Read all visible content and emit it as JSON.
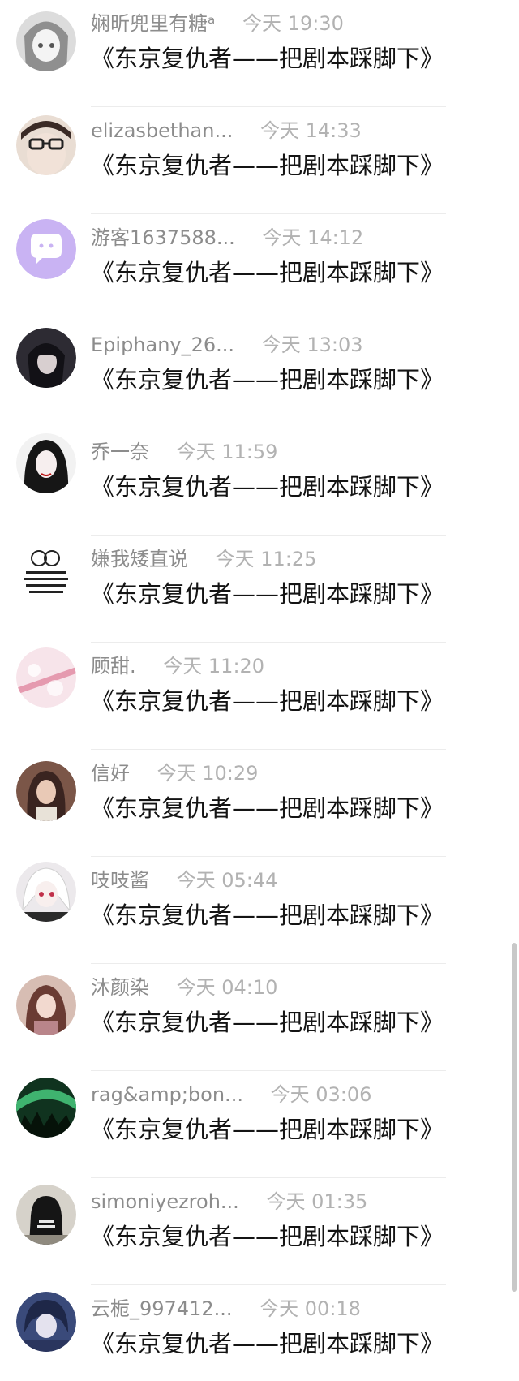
{
  "comments": [
    {
      "user": "娴昕兜里有糖ᵃ",
      "time": "今天 19:30",
      "text": "《东京复仇者——把剧本踩脚下》",
      "avatar_icon": "avatar-anime-girl-grayscale-icon",
      "avatar_color": "#d9d9d9"
    },
    {
      "user": "elizasbethan...",
      "time": "今天 14:33",
      "text": "《东京复仇者——把剧本踩脚下》",
      "avatar_icon": "avatar-glasses-person-icon",
      "avatar_color": "#e2d6ce"
    },
    {
      "user": "游客1637588...",
      "time": "今天 14:12",
      "text": "《东京复仇者——把剧本踩脚下》",
      "avatar_icon": "avatar-default-chat-bubble-icon",
      "avatar_color": "#c9b3f3"
    },
    {
      "user": "Epiphany_26...",
      "time": "今天 13:03",
      "text": "《东京复仇者——把剧本踩脚下》",
      "avatar_icon": "avatar-dark-anime-character-icon",
      "avatar_color": "#2d2b33"
    },
    {
      "user": "乔一奈",
      "time": "今天 11:59",
      "text": "《东京复仇者——把剧本踩脚下》",
      "avatar_icon": "avatar-dark-haired-girl-icon",
      "avatar_color": "#1a1a1a"
    },
    {
      "user": "嫌我矮直说",
      "time": "今天 11:25",
      "text": "《东京复仇者——把剧本踩脚下》",
      "avatar_icon": "avatar-meme-text-icon",
      "avatar_color": "#ffffff"
    },
    {
      "user": "顾甜.",
      "time": "今天 11:20",
      "text": "《东京复仇者——把剧本踩脚下》",
      "avatar_icon": "avatar-pink-blossom-icon",
      "avatar_color": "#f3d6df"
    },
    {
      "user": "信好",
      "time": "今天 10:29",
      "text": "《东京复仇者——把剧本踩脚下》",
      "avatar_icon": "avatar-photo-girl-icon",
      "avatar_color": "#6b4a3c"
    },
    {
      "user": "吱吱酱",
      "time": "今天 05:44",
      "text": "《东京复仇者——把剧本踩脚下》",
      "avatar_icon": "avatar-white-haired-anime-icon",
      "avatar_color": "#e8e4e8"
    },
    {
      "user": "沐颜染",
      "time": "今天 04:10",
      "text": "《东京复仇者——把剧本踩脚下》",
      "avatar_icon": "avatar-illustrated-girl-icon",
      "avatar_color": "#c9a59a"
    },
    {
      "user": "rag&amp;bon...",
      "time": "今天 03:06",
      "text": "《东京复仇者——把剧本踩脚下》",
      "avatar_icon": "avatar-aurora-landscape-icon",
      "avatar_color": "#2e6b47"
    },
    {
      "user": "simoniyezroh...",
      "time": "今天 01:35",
      "text": "《东京复仇者——把剧本踩脚下》",
      "avatar_icon": "avatar-hooded-person-icon",
      "avatar_color": "#b9b4ab"
    },
    {
      "user": "云栀_997412...",
      "time": "今天 00:18",
      "text": "《东京复仇者——把剧本踩脚下》",
      "avatar_icon": "avatar-blue-anime-boy-icon",
      "avatar_color": "#3a4a7a"
    }
  ],
  "colors": {
    "username": "#8c8c8c",
    "time": "#b2b2b2",
    "message": "#141414",
    "divider": "#ececec",
    "scrollbar": "#c8c8c8"
  }
}
